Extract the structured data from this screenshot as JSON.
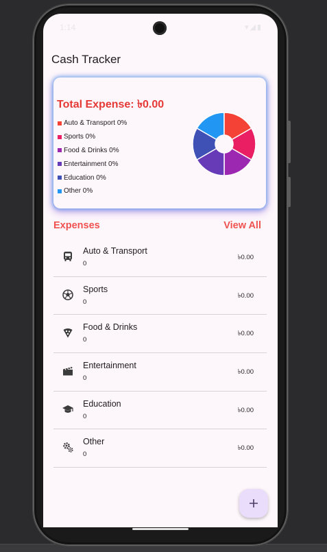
{
  "app": {
    "title": "Cash Tracker"
  },
  "status_bar": {
    "time": "1:14",
    "icons": "▾◢▮"
  },
  "summary": {
    "total_label": "Total Expense: ৳0.00",
    "legend": [
      {
        "label": "Auto & Transport 0%",
        "color": "#f44336"
      },
      {
        "label": "Sports 0%",
        "color": "#e91e63"
      },
      {
        "label": "Food & Drinks 0%",
        "color": "#9c27b0"
      },
      {
        "label": "Entertainment 0%",
        "color": "#673ab7"
      },
      {
        "label": "Education 0%",
        "color": "#3f51b5"
      },
      {
        "label": "Other 0%",
        "color": "#2196f3"
      }
    ]
  },
  "chart_data": {
    "type": "pie",
    "labels": [
      "Auto & Transport",
      "Sports",
      "Food & Drinks",
      "Entertainment",
      "Education",
      "Other"
    ],
    "values": [
      0,
      0,
      0,
      0,
      0,
      0
    ],
    "colors": [
      "#f44336",
      "#e91e63",
      "#9c27b0",
      "#673ab7",
      "#3f51b5",
      "#2196f3"
    ],
    "donut": true
  },
  "expenses_section": {
    "title": "Expenses",
    "view_all": "View All"
  },
  "expenses": [
    {
      "name": "Auto & Transport",
      "count": "0",
      "amount": "৳0.00",
      "icon": "bus-icon"
    },
    {
      "name": "Sports",
      "count": "0",
      "amount": "৳0.00",
      "icon": "soccer-ball-icon"
    },
    {
      "name": "Food & Drinks",
      "count": "0",
      "amount": "৳0.00",
      "icon": "pizza-icon"
    },
    {
      "name": "Entertainment",
      "count": "0",
      "amount": "৳0.00",
      "icon": "clapperboard-icon"
    },
    {
      "name": "Education",
      "count": "0",
      "amount": "৳0.00",
      "icon": "graduation-cap-icon"
    },
    {
      "name": "Other",
      "count": "0",
      "amount": "৳0.00",
      "icon": "gears-icon"
    }
  ],
  "fab": {
    "icon": "plus-icon"
  }
}
